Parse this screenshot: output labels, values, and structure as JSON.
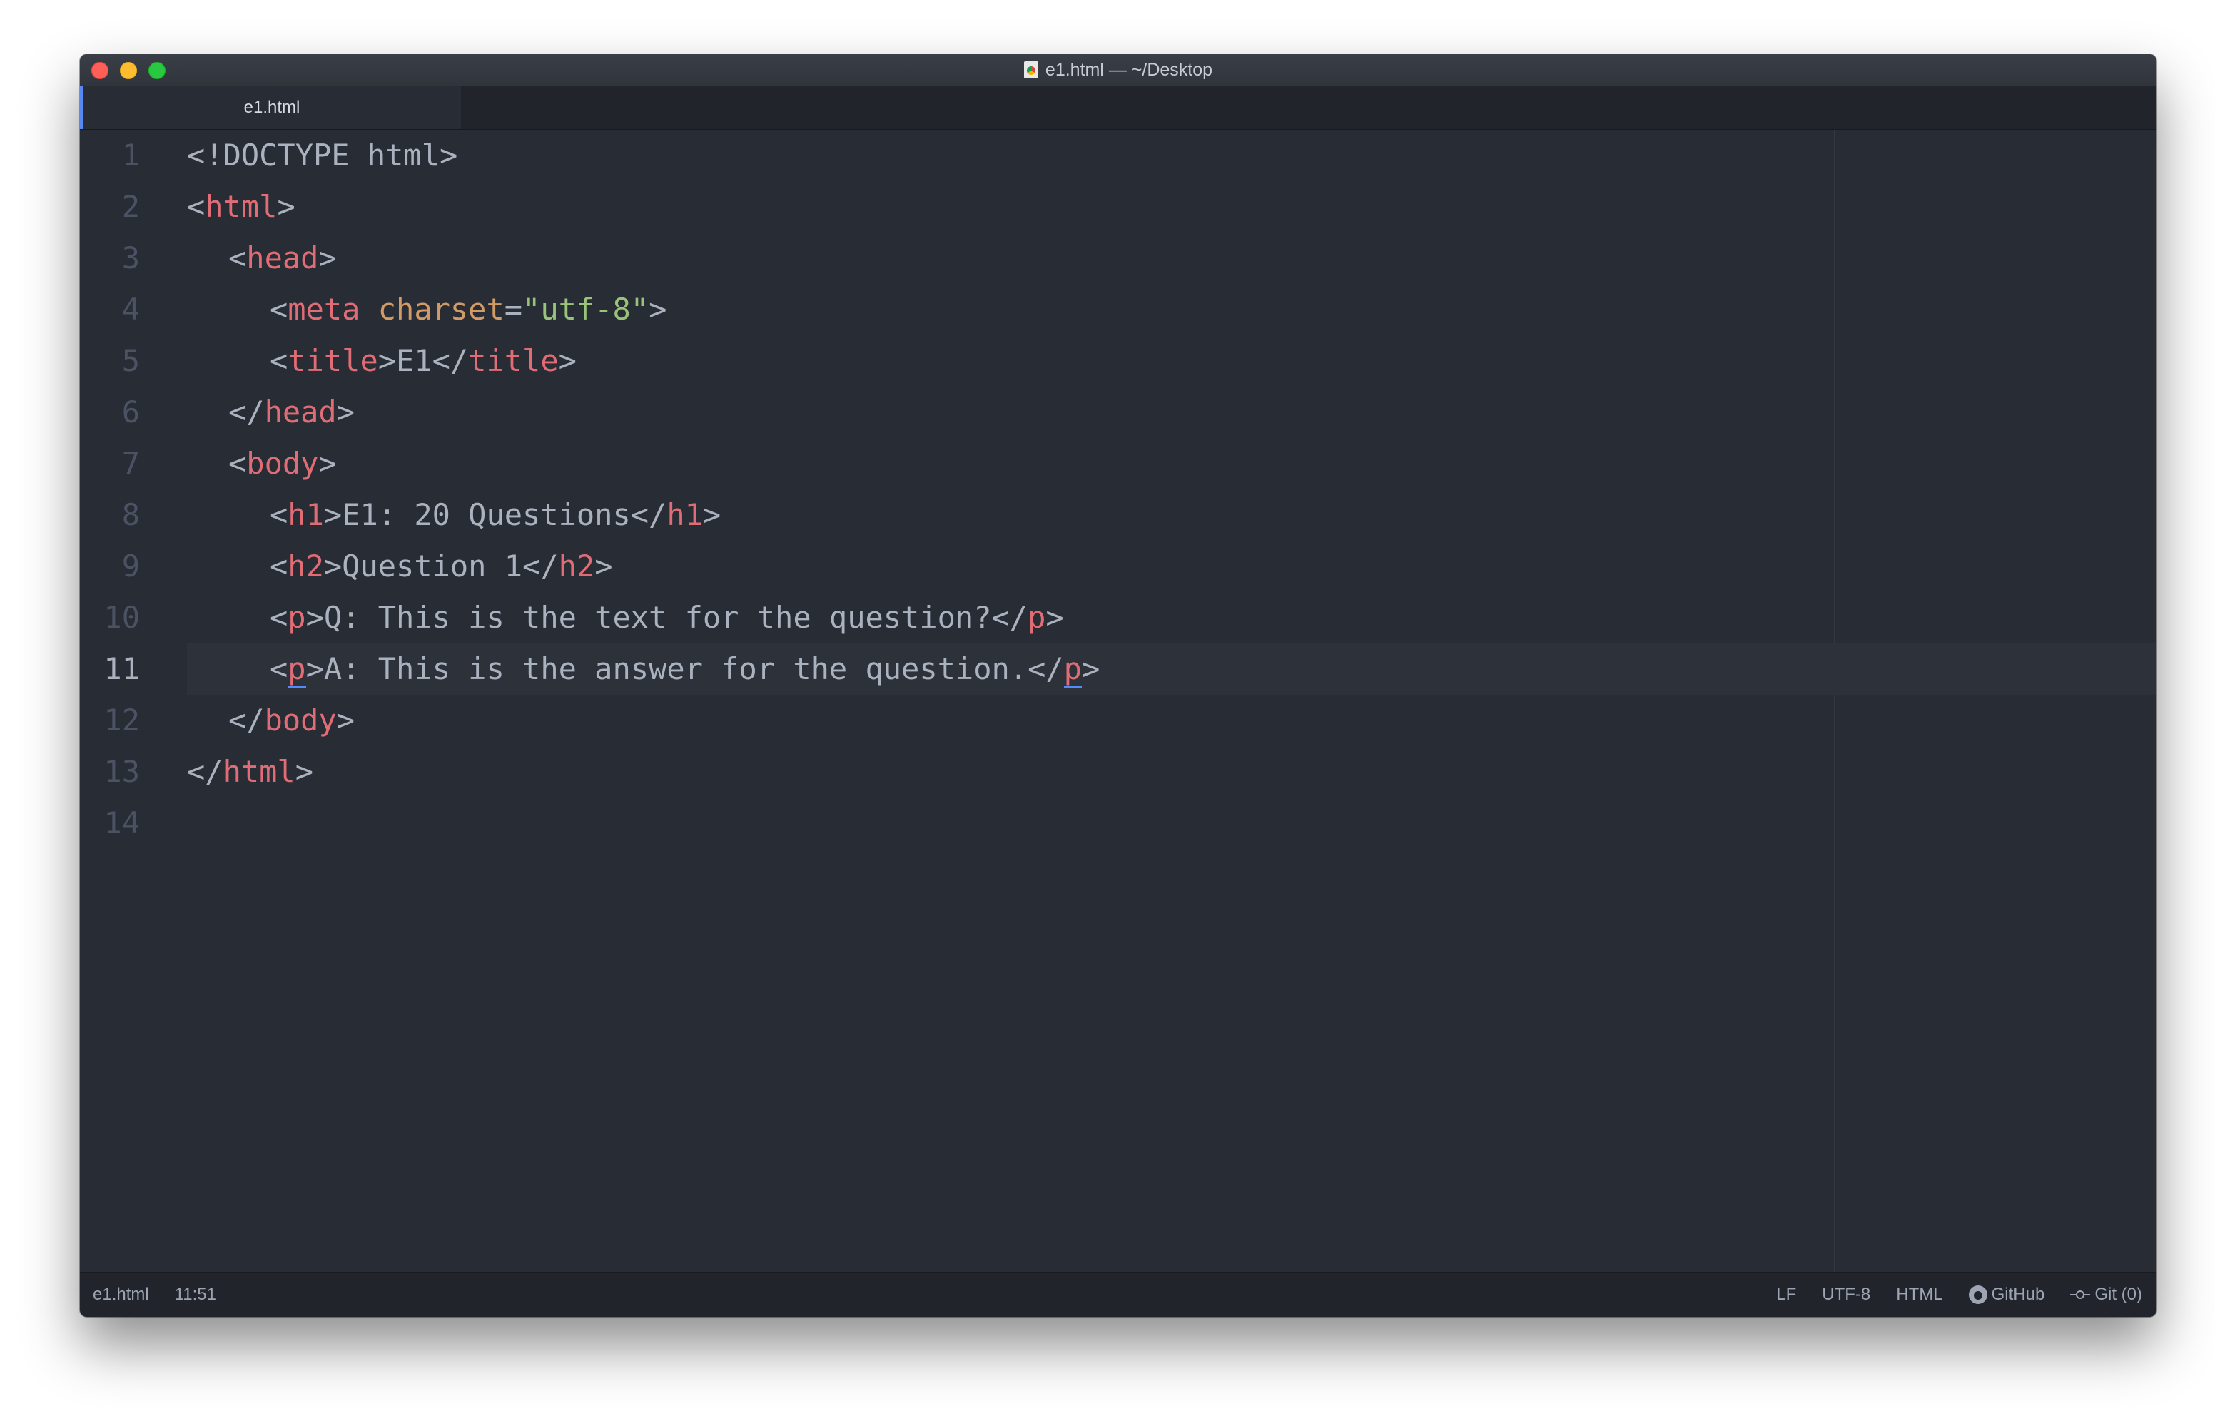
{
  "window": {
    "title": "e1.html — ~/Desktop"
  },
  "tabs": [
    {
      "label": "e1.html",
      "active": true
    }
  ],
  "editor": {
    "cursor_line": 11,
    "lines": [
      {
        "n": "1"
      },
      {
        "n": "2"
      },
      {
        "n": "3"
      },
      {
        "n": "4"
      },
      {
        "n": "5"
      },
      {
        "n": "6"
      },
      {
        "n": "7"
      },
      {
        "n": "8"
      },
      {
        "n": "9"
      },
      {
        "n": "10"
      },
      {
        "n": "11"
      },
      {
        "n": "12"
      },
      {
        "n": "13"
      },
      {
        "n": "14"
      }
    ],
    "code": {
      "l1_doctype": "<!DOCTYPE html>",
      "lt": "<",
      "gt": ">",
      "lts": "</",
      "html": "html",
      "head": "head",
      "meta": "meta",
      "charset_attr": "charset",
      "eq": "=",
      "charset_val": "\"utf-8\"",
      "title_tag": "title",
      "title_text": "E1",
      "body": "body",
      "h1": "h1",
      "h1_text": "E1: 20 Questions",
      "h2": "h2",
      "h2_text": "Question 1",
      "p": "p",
      "p1_text": "Q: This is the text for the question?",
      "p2_text": "A: This is the answer for the question."
    }
  },
  "status": {
    "file": "e1.html",
    "position": "11:51",
    "line_ending": "LF",
    "encoding": "UTF-8",
    "grammar": "HTML",
    "github": "GitHub",
    "git": "Git (0)"
  },
  "colors": {
    "background": "#282c34",
    "tag": "#e06c75",
    "attribute": "#d19a66",
    "string": "#98c379",
    "text": "#abb2bf",
    "gutter": "#4b5263",
    "accent": "#528bff"
  },
  "icons": {
    "title_file": "html-file-icon",
    "github": "github-icon",
    "git": "git-commit-icon"
  }
}
